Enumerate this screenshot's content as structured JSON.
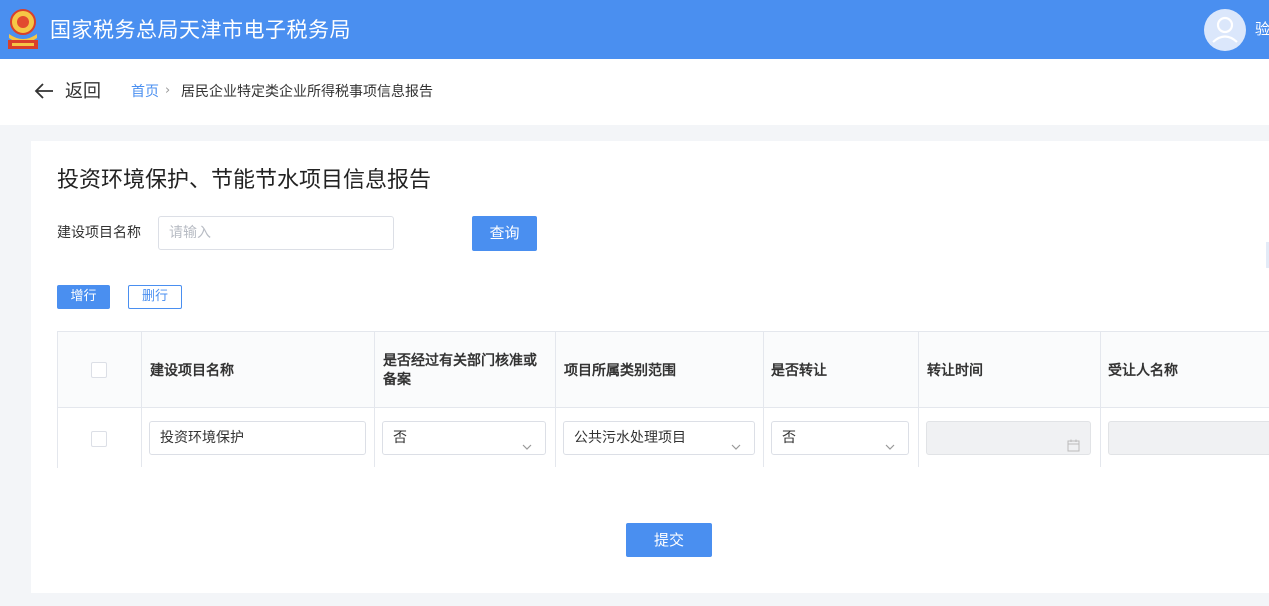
{
  "header": {
    "app_title": "国家税务总局天津市电子税务局",
    "user_name": "验"
  },
  "subbar": {
    "back_label": "返回",
    "breadcrumb_home": "首页",
    "breadcrumb_separator": "›",
    "breadcrumb_current": "居民企业特定类企业所得税事项信息报告"
  },
  "main": {
    "page_title": "投资环境保护、节能节水项目信息报告",
    "search": {
      "label": "建设项目名称",
      "placeholder": "请输入",
      "value": "",
      "button_label": "查询"
    },
    "toolbar": {
      "add_row_label": "增行",
      "delete_row_label": "删行"
    },
    "table": {
      "columns": [
        "建设项目名称",
        "是否经过有关部门核准或备案",
        "项目所属类别范围",
        "是否转让",
        "转让时间",
        "受让人名称"
      ],
      "rows": [
        {
          "checked": false,
          "project_name": "投资环境保护",
          "approved": "否",
          "category": "公共污水处理项目",
          "transferred": "否",
          "transfer_time": "",
          "transferee_name": ""
        }
      ]
    },
    "submit_label": "提交"
  },
  "icons": {
    "logo": "tax-emblem-icon",
    "avatar": "user-avatar-icon",
    "back": "arrow-left-icon",
    "select": "chevron-down-icon",
    "date": "calendar-icon"
  },
  "colors": {
    "primary": "#4a8ff0",
    "header_bg": "#4a8ff0",
    "page_bg": "#f3f5f8"
  }
}
